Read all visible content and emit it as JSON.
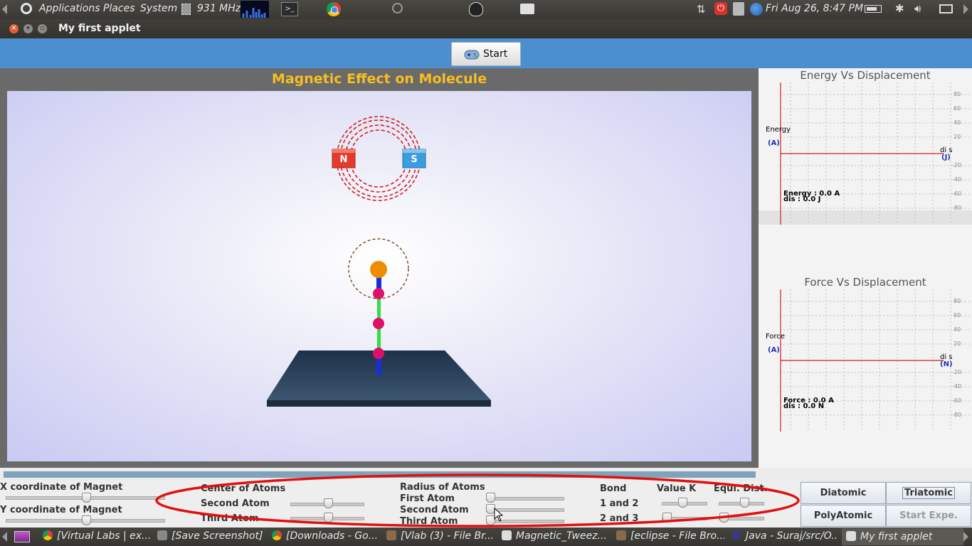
{
  "top_panel": {
    "menus": [
      "Applications",
      "Places",
      "System"
    ],
    "cpu_freq": "931 MHz",
    "datetime": "Fri Aug 26,  8:47 PM"
  },
  "window": {
    "title": "My first applet"
  },
  "toolbar": {
    "start_label": "Start"
  },
  "simulation": {
    "title": "Magnetic Effect on Molecule",
    "magnet_north": "N",
    "magnet_south": "S"
  },
  "graphs": {
    "energy": {
      "title": "Energy Vs Displacement",
      "y_label": "Energy",
      "y_unit": "(A)",
      "x_label": "di s",
      "x_unit": "(J)",
      "readout_1": "Energy : 0.0 A",
      "readout_2": "dis : 0.0 J",
      "ticks": [
        "80",
        "60",
        "40",
        "20",
        "-20",
        "-40",
        "-60",
        "-80"
      ]
    },
    "force": {
      "title": "Force Vs Displacement",
      "y_label": "Force",
      "y_unit": "(A)",
      "x_label": "di s",
      "x_unit": "(N)",
      "readout_1": "Force : 0.0 A",
      "readout_2": "dis : 0.0 N",
      "ticks": [
        "80",
        "60",
        "40",
        "20",
        "-20",
        "-40",
        "-60",
        "-80"
      ]
    }
  },
  "controls": {
    "x_magnet_label": "X coordinate of Magnet",
    "y_magnet_label": "Y coordinate of Magnet",
    "center_atoms_label": "Center of Atoms",
    "second_atom_label": "Second Atom",
    "third_atom_label": "Third Atom",
    "radius_atoms_label": "Radius of Atoms",
    "first_atom_label": "First Atom",
    "radius_second_label": "Second Atom",
    "radius_third_label": "Third Atom",
    "bond_label": "Bond",
    "bond_1_2": "1 and 2",
    "bond_2_3": "2 and 3",
    "value_k_label": "Value K",
    "equi_dist_label": "Equi. Dist."
  },
  "buttons": {
    "diatomic": "Diatomic",
    "triatomic": "Triatomic",
    "polyatomic": "PolyAtomic",
    "start_expe": "Start Expe."
  },
  "taskbar": {
    "items": [
      "[Virtual Labs | ex...",
      "[Save Screenshot]",
      "[Downloads - Go...",
      "[Vlab (3) - File Br...",
      "Magnetic_Tweez...",
      "[eclipse - File Bro...",
      "Java - Suraj/src/O...",
      "My first applet"
    ]
  },
  "colors": {
    "title_yellow": "#f7bf1f",
    "blue_bar": "#4b8fcf",
    "magnet_north": "#e53b2c",
    "magnet_south": "#3b9de0",
    "graph_axis": "#cc2222",
    "annotation_ellipse": "#e01010"
  }
}
